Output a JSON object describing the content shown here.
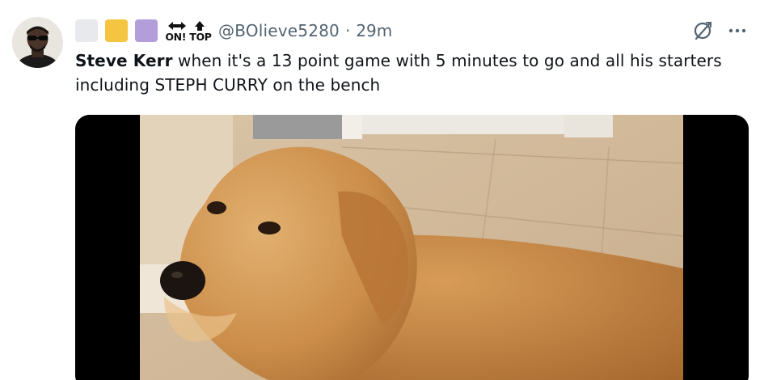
{
  "tweet": {
    "handle": "@BOlieve5280",
    "separator": "·",
    "time": "29m",
    "author_in_text": "Steve Kerr",
    "text": " when it's a 13 point game with  5 minutes to go and all his starters including STEPH CURRY on the bench"
  },
  "badges": [
    {
      "name": "grey-square",
      "color": "#e7e9ec"
    },
    {
      "name": "yellow-square",
      "color": "#f5c542"
    },
    {
      "name": "purple-square",
      "color": "#b39ddb"
    }
  ],
  "logo_badge": {
    "text": "ON! TOP"
  },
  "icons": {
    "grok": "grok-icon",
    "more": "more-icon"
  },
  "colors": {
    "text_primary": "#0f1419",
    "text_secondary": "#536471",
    "media_letterbox": "#000000"
  }
}
